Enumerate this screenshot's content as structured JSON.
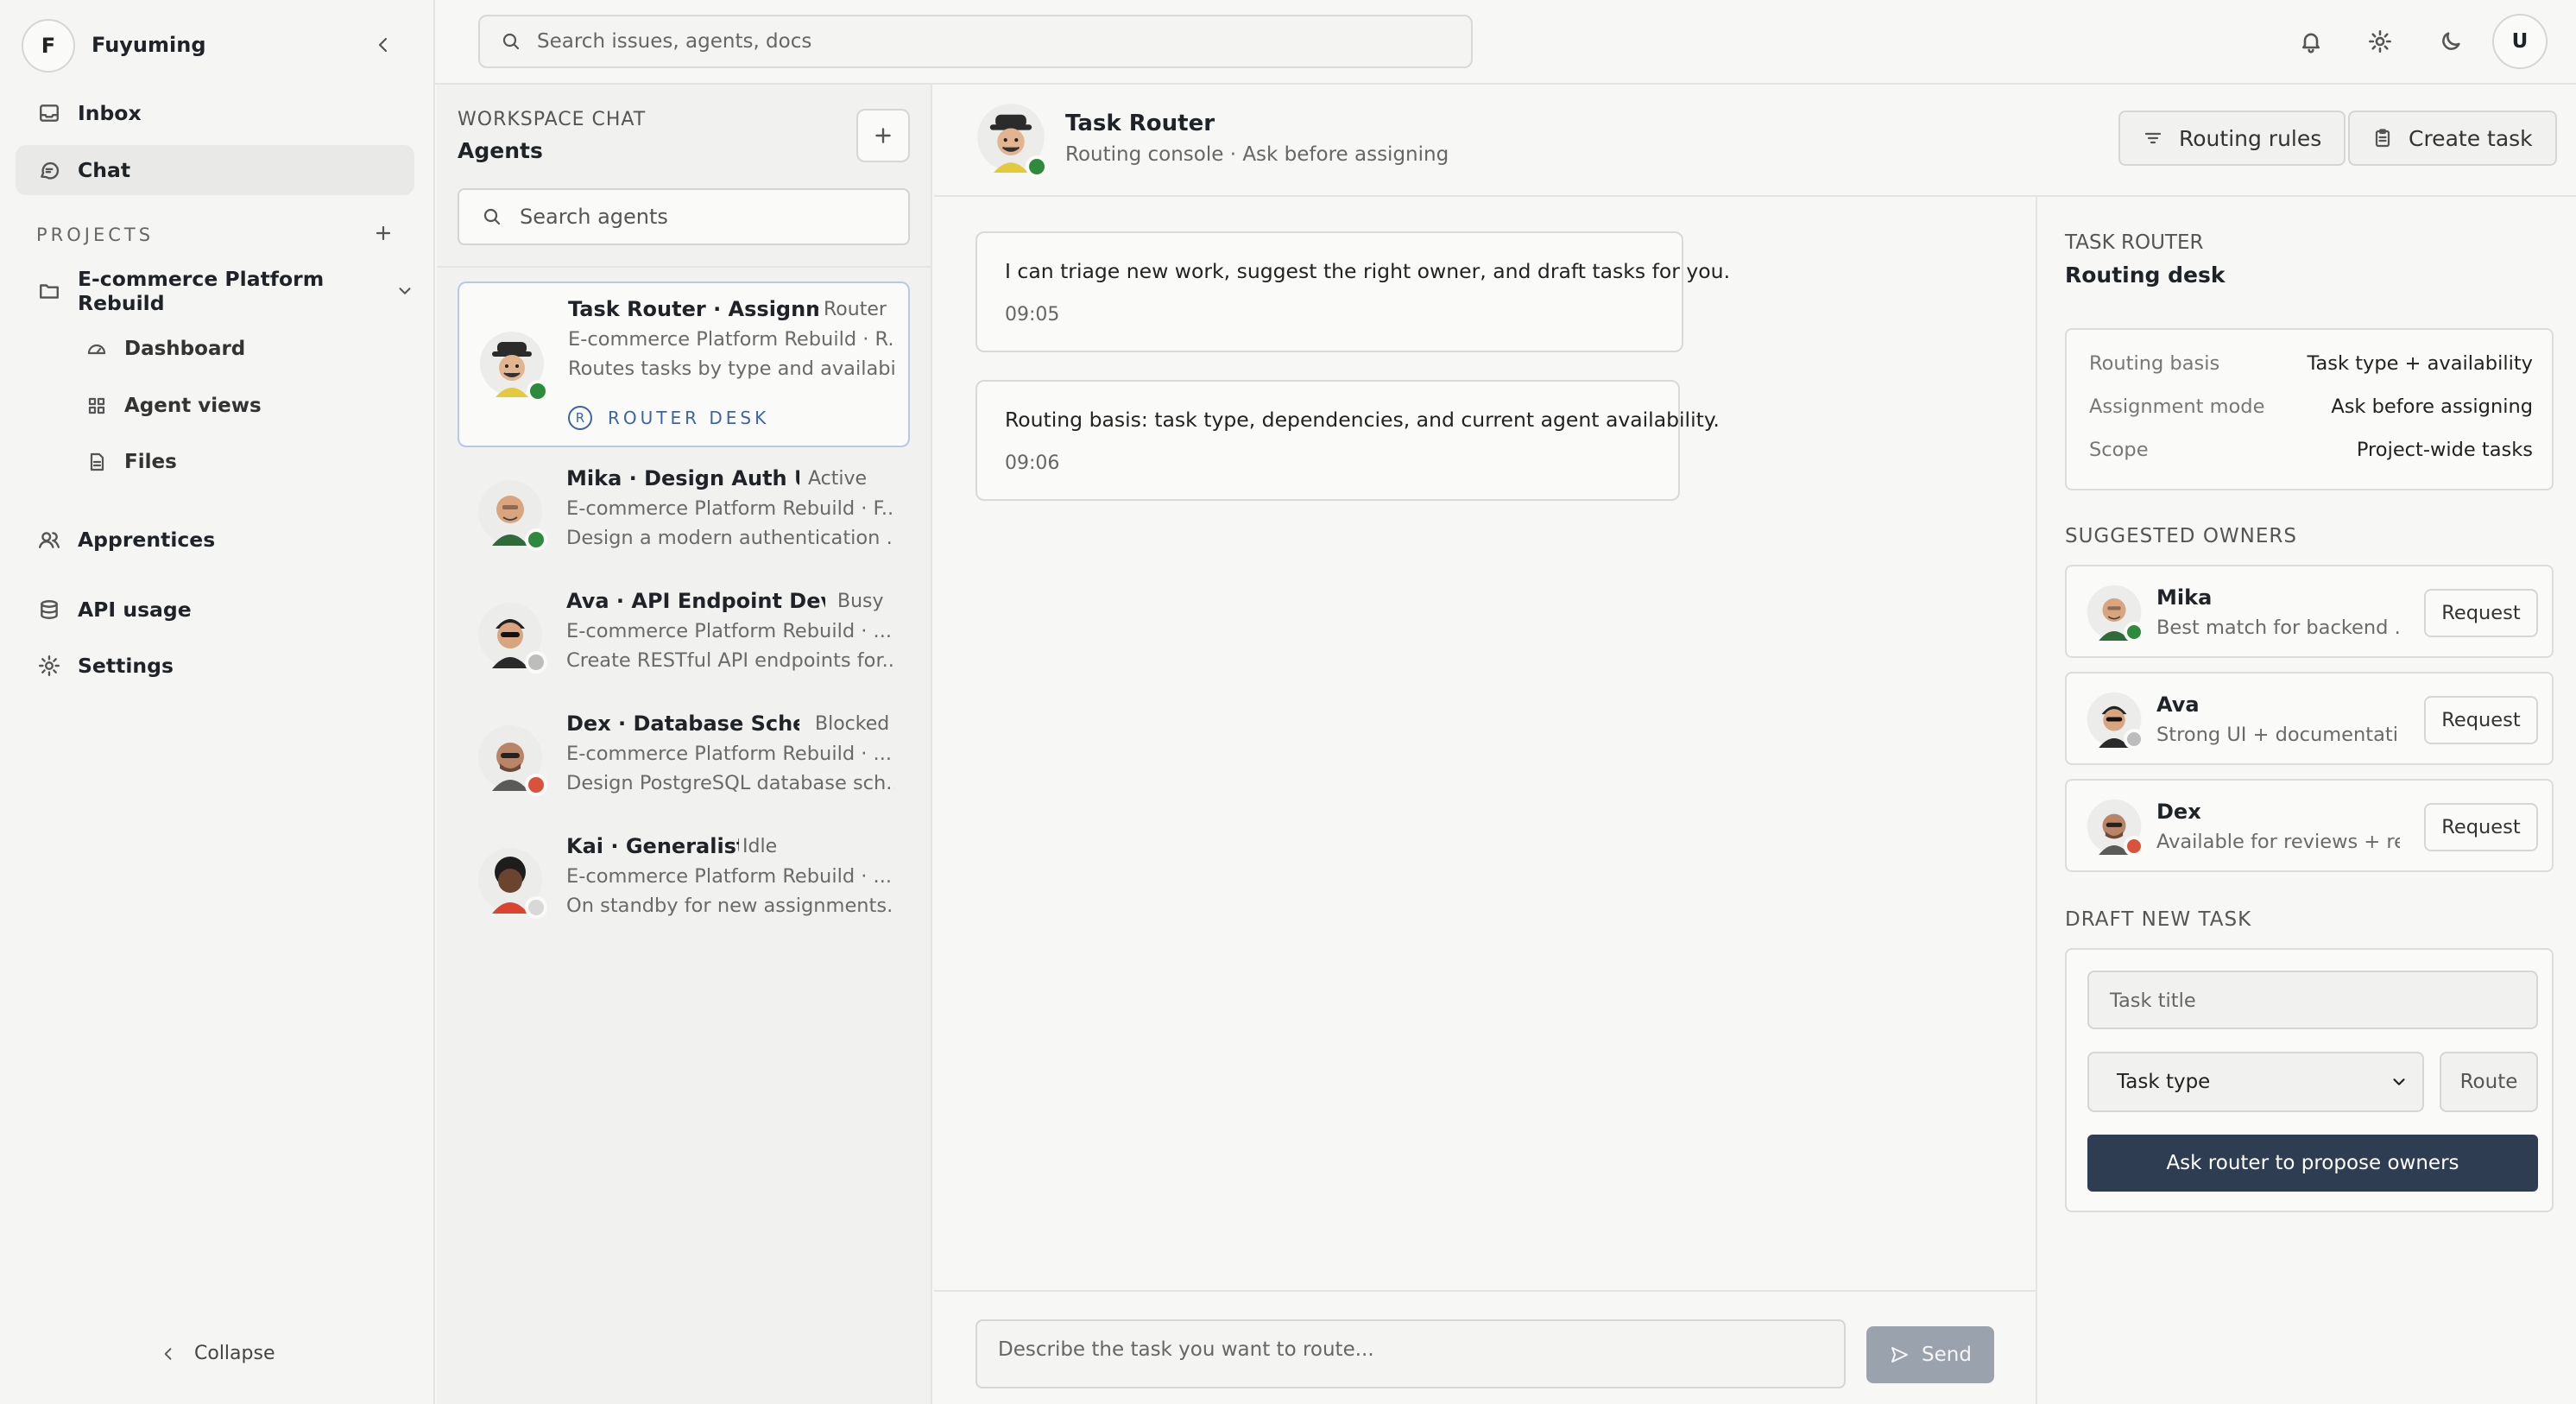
{
  "workspace": {
    "initial": "F",
    "name": "Fuyuming"
  },
  "nav": {
    "inbox": "Inbox",
    "chat": "Chat"
  },
  "projects": {
    "label": "PROJECTS",
    "project_name": "E-commerce Platform Rebuild",
    "sub_items": [
      "Dashboard",
      "Agent views",
      "Files"
    ]
  },
  "nav2": {
    "apprentices": "Apprentices",
    "api_usage": "API usage",
    "settings": "Settings"
  },
  "collapse_label": "Collapse",
  "topbar": {
    "search_placeholder": "Search issues, agents, docs",
    "user_initial": "U"
  },
  "agents_panel": {
    "small_heading": "WORKSPACE CHAT",
    "heading": "Agents",
    "search_placeholder": "Search agents",
    "router_badge_letter": "R",
    "router_badge": "ROUTER DESK",
    "agents": [
      {
        "title": "Task Router · Assignm...",
        "tag": "Router",
        "line1": "E-commerce Platform Rebuild · R...",
        "line2": "Routes tasks by type and availabi...",
        "status": "online",
        "status_color": "#2e8b3e"
      },
      {
        "title": "Mika · Design Auth UI",
        "tag": "Active",
        "line1": "E-commerce Platform Rebuild · F...",
        "line2": "Design a modern authentication ...",
        "status": "online",
        "status_color": "#2e8b3e"
      },
      {
        "title": "Ava · API Endpoint Dev...",
        "tag": "Busy",
        "line1": "E-commerce Platform Rebuild · ...",
        "line2": "Create RESTful API endpoints for...",
        "status": "busy",
        "status_color": "#bdbdbd"
      },
      {
        "title": "Dex · Database Sche...",
        "tag": "Blocked",
        "line1": "E-commerce Platform Rebuild · ...",
        "line2": "Design PostgreSQL database sch...",
        "status": "blocked",
        "status_color": "#d9533c"
      },
      {
        "title": "Kai · Generalist",
        "tag": "Idle",
        "line1": "E-commerce Platform Rebuild · ...",
        "line2": "On standby for new assignments.",
        "status": "idle",
        "status_color": "#d8d8d8"
      }
    ]
  },
  "chat": {
    "title": "Task Router",
    "subtitle": "Routing console · Ask before assigning",
    "routing_rules_label": "Routing rules",
    "create_task_label": "Create task",
    "messages": [
      {
        "text": "I can triage new work, suggest the right owner, and draft tasks for you.",
        "time": "09:05"
      },
      {
        "text": "Routing basis: task type, dependencies, and current agent availability.",
        "time": "09:06"
      }
    ],
    "composer_placeholder": "Describe the task you want to route...",
    "send_label": "Send"
  },
  "right_panel": {
    "small_heading": "TASK ROUTER",
    "title": "Routing desk",
    "info": [
      {
        "key": "Routing basis",
        "value": "Task type + availability"
      },
      {
        "key": "Assignment mode",
        "value": "Ask before assigning"
      },
      {
        "key": "Scope",
        "value": "Project-wide tasks"
      }
    ],
    "suggested_heading": "SUGGESTED OWNERS",
    "owners": [
      {
        "name": "Mika",
        "desc": "Best match for backend ...",
        "button": "Request",
        "status_color": "#2e8b3e"
      },
      {
        "name": "Ava",
        "desc": "Strong UI + documentati...",
        "button": "Request",
        "status_color": "#bdbdbd"
      },
      {
        "name": "Dex",
        "desc": "Available for reviews + re...",
        "button": "Request",
        "status_color": "#d9533c"
      }
    ],
    "draft_heading": "DRAFT NEW TASK",
    "task_title_placeholder": "Task title",
    "task_type_selected": "Task type",
    "route_label": "Route",
    "propose_label": "Ask router to propose owners"
  },
  "colors": {
    "accent_dark": "#2e3d52",
    "selection_border": "#b8c8e6",
    "router_badge": "#3d64a6"
  }
}
